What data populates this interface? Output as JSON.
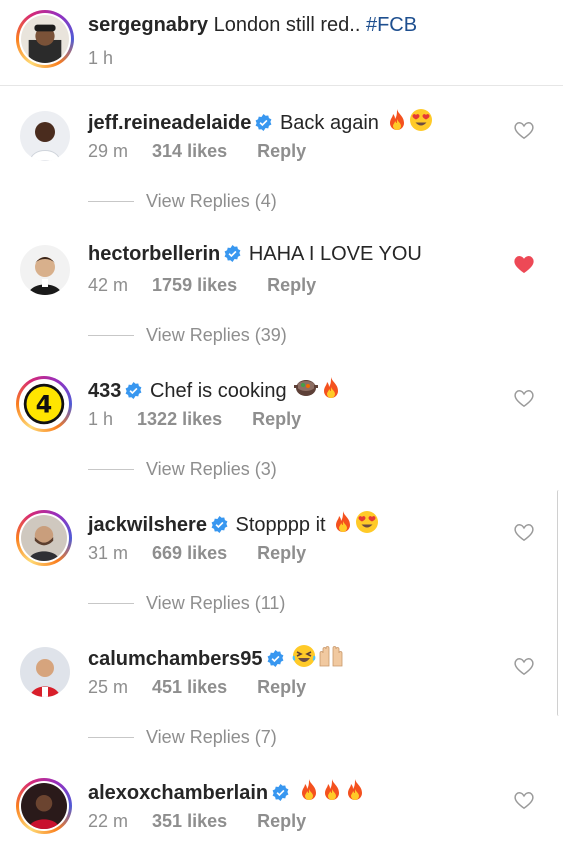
{
  "caption": {
    "username": "sergegnabry",
    "text": "London still red..",
    "hashtag": "#FCB",
    "time": "1 h"
  },
  "comments": [
    {
      "username": "jeff.reineadelaide",
      "text": "Back again",
      "emojis": [
        "fire",
        "heart-eyes"
      ],
      "time": "29 m",
      "likes": "314 likes",
      "reply": "Reply",
      "view_replies": "View Replies (4)",
      "liked": false
    },
    {
      "username": "hectorbellerin",
      "text": "HAHA I LOVE YOU",
      "emojis": [],
      "time": "42 m",
      "likes": "1759 likes",
      "reply": "Reply",
      "view_replies": "View Replies (39)",
      "liked": true
    },
    {
      "username": "433",
      "text": "Chef is cooking",
      "emojis": [
        "stew",
        "fire"
      ],
      "time": "1 h",
      "likes": "1322 likes",
      "reply": "Reply",
      "view_replies": "View Replies (3)",
      "liked": false
    },
    {
      "username": "jackwilshere",
      "text": "Stopppp it",
      "emojis": [
        "fire",
        "heart-eyes"
      ],
      "time": "31 m",
      "likes": "669 likes",
      "reply": "Reply",
      "view_replies": "View Replies (11)",
      "liked": false
    },
    {
      "username": "calumchambers95",
      "text": "",
      "emojis": [
        "laughing",
        "raised-hands"
      ],
      "time": "25 m",
      "likes": "451 likes",
      "reply": "Reply",
      "view_replies": "View Replies (7)",
      "liked": false
    },
    {
      "username": "alexoxchamberlain",
      "text": "",
      "emojis": [
        "fire",
        "fire",
        "fire"
      ],
      "time": "22 m",
      "likes": "351 likes",
      "reply": "Reply",
      "view_replies": "",
      "liked": false
    }
  ],
  "colors": {
    "verified": "#3897f0",
    "liked_heart": "#ed4956",
    "hashtag": "#1e4f8f",
    "meta": "#8e8e8e"
  }
}
